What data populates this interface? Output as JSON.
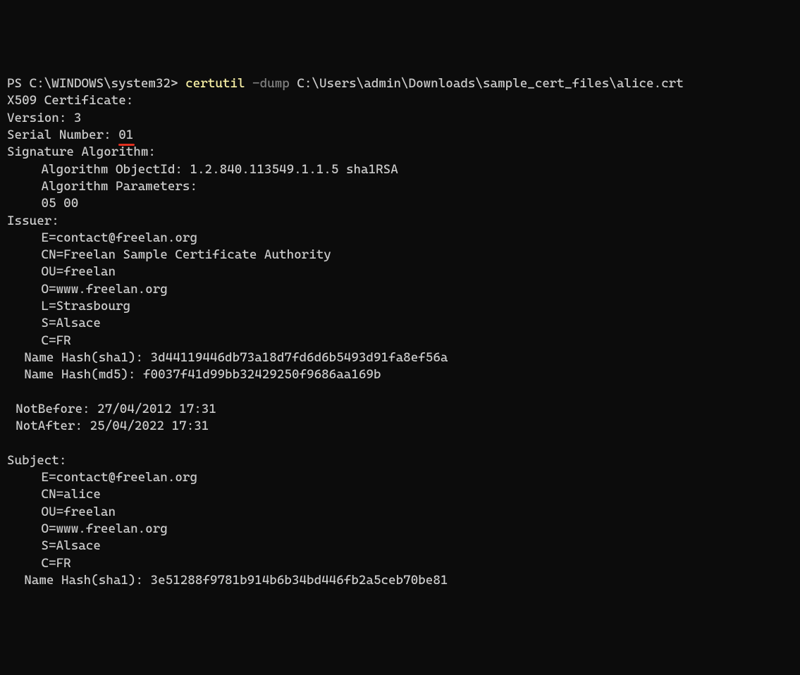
{
  "prompt": {
    "prefix": "PS C:\\WINDOWS\\system32>",
    "command": "certutil",
    "flag": "-dump",
    "path": "C:\\Users\\admin\\Downloads\\sample_cert_files\\alice.crt"
  },
  "output": {
    "heading": "X509 Certificate:",
    "version_label": "Version:",
    "version_value": "3",
    "serial_label": "Serial Number:",
    "serial_value": "01",
    "sig_alg_label": "Signature Algorithm:",
    "alg_objid_label": "Algorithm ObjectId:",
    "alg_objid_value": "1.2.840.113549.1.1.5 sha1RSA",
    "alg_params_label": "Algorithm Parameters:",
    "alg_params_value": "05 00",
    "issuer_label": "Issuer:",
    "issuer": {
      "e": "E=contact@freelan.org",
      "cn": "CN=Freelan Sample Certificate Authority",
      "ou": "OU=freelan",
      "o": "O=www.freelan.org",
      "l": "L=Strasbourg",
      "s": "S=Alsace",
      "c": "C=FR"
    },
    "issuer_hash_sha1_label": "Name Hash(sha1):",
    "issuer_hash_sha1": "3d44119446db73a18d7fd6d6b5493d91fa8ef56a",
    "issuer_hash_md5_label": "Name Hash(md5):",
    "issuer_hash_md5": "f0037f41d99bb32429250f9686aa169b",
    "notbefore_label": "NotBefore:",
    "notbefore": "27/04/2012 17:31",
    "notafter_label": "NotAfter:",
    "notafter": "25/04/2022 17:31",
    "subject_label": "Subject:",
    "subject": {
      "e": "E=contact@freelan.org",
      "cn": "CN=alice",
      "ou": "OU=freelan",
      "o": "O=www.freelan.org",
      "s": "S=Alsace",
      "c": "C=FR"
    },
    "subject_hash_sha1_label": "Name Hash(sha1):",
    "subject_hash_sha1": "3e51288f9781b914b6b34bd446fb2a5ceb70be81"
  }
}
